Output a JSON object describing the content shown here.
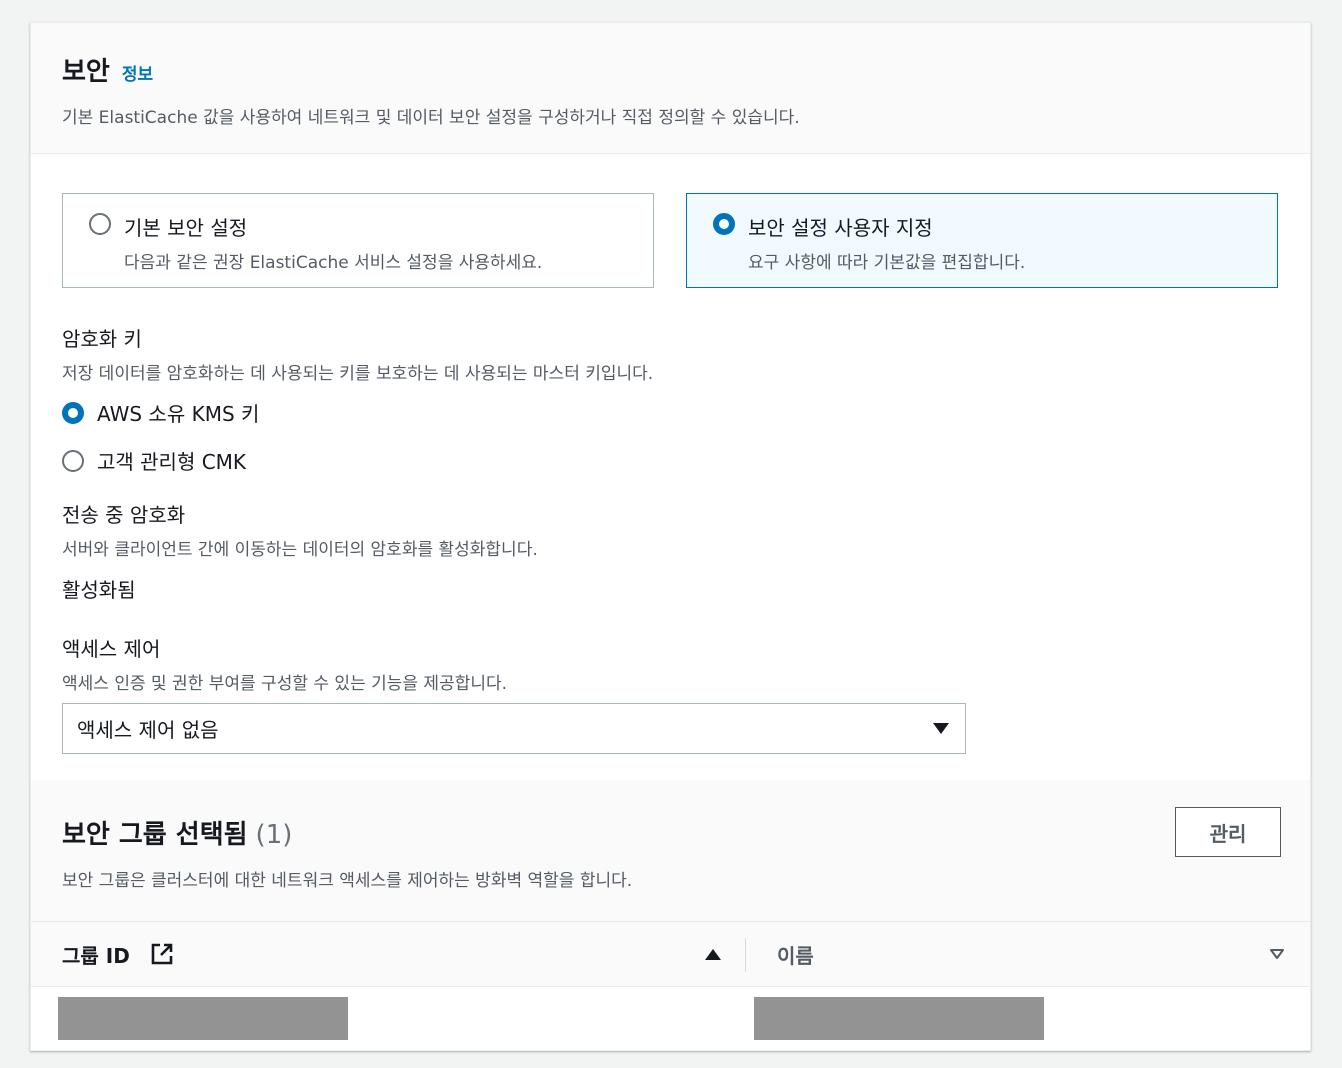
{
  "header": {
    "title": "보안",
    "info_link": "정보",
    "description": "기본 ElastiCache 값을 사용하여 네트워크 및 데이터 보안 설정을 구성하거나 직접 정의할 수 있습니다."
  },
  "tiles": [
    {
      "label": "기본 보안 설정",
      "description": "다음과 같은 권장 ElastiCache 서비스 설정을 사용하세요.",
      "selected": false
    },
    {
      "label": "보안 설정 사용자 지정",
      "description": "요구 사항에 따라 기본값을 편집합니다.",
      "selected": true
    }
  ],
  "encryption_key": {
    "label": "암호화 키",
    "description": "저장 데이터를 암호화하는 데 사용되는 키를 보호하는 데 사용되는 마스터 키입니다.",
    "options": [
      {
        "label": "AWS 소유 KMS 키",
        "selected": true
      },
      {
        "label": "고객 관리형 CMK",
        "selected": false
      }
    ]
  },
  "in_transit": {
    "label": "전송 중 암호화",
    "description": "서버와 클라이언트 간에 이동하는 데이터의 암호화를 활성화합니다.",
    "value": "활성화됨"
  },
  "access_control": {
    "label": "액세스 제어",
    "description": "액세스 인증 및 권한 부여를 구성할 수 있는 기능을 제공합니다.",
    "selected": "액세스 제어 없음"
  },
  "security_groups": {
    "title": "보안 그룹 선택됨",
    "count": "(1)",
    "description": "보안 그룹은 클러스터에 대한 네트워크 액세스를 제어하는 방화벽 역할을 합니다.",
    "manage_label": "관리",
    "columns": [
      "그룹 ID",
      "이름"
    ]
  },
  "colors": {
    "accent": "#0073bb",
    "selected_tile_bg": "#f1faff",
    "redaction": "#939393"
  }
}
